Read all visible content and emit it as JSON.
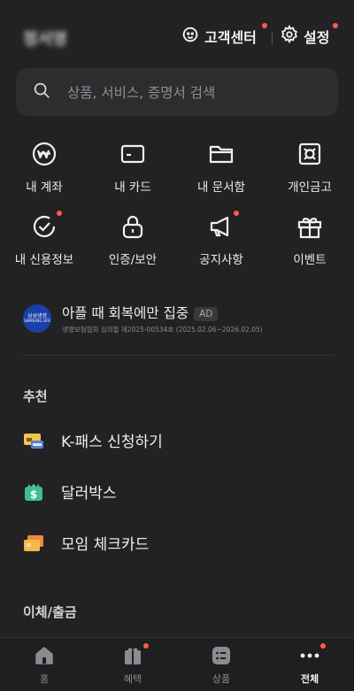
{
  "header": {
    "username": "정서영",
    "support_label": "고객센터",
    "settings_label": "설정"
  },
  "search": {
    "placeholder": "상품, 서비스, 증명서 검색"
  },
  "quick_menu": [
    {
      "label": "내 계좌",
      "icon": "account-won-icon"
    },
    {
      "label": "내 카드",
      "icon": "card-icon"
    },
    {
      "label": "내 문서함",
      "icon": "folder-icon"
    },
    {
      "label": "개인금고",
      "icon": "safe-icon"
    },
    {
      "label": "내 신용정보",
      "icon": "credit-check-icon",
      "badge": true
    },
    {
      "label": "인증/보안",
      "icon": "lock-icon"
    },
    {
      "label": "공지사항",
      "icon": "megaphone-icon",
      "badge": true
    },
    {
      "label": "이벤트",
      "icon": "gift-icon"
    }
  ],
  "ad": {
    "logo_line1": "삼성생명",
    "logo_line2": "SAMSUNG LIFE",
    "title": "아플 때 회복에만 집중",
    "badge": "AD",
    "subtitle": "생명보험협회 심의필 제2025-00534호 (2025.02.06~2026.02.05)"
  },
  "recommend": {
    "title": "추천",
    "items": [
      {
        "label": "K-패스 신청하기",
        "icon": "kpass-card-icon"
      },
      {
        "label": "달러박스",
        "icon": "dollar-box-icon"
      },
      {
        "label": "모임 체크카드",
        "icon": "group-card-icon"
      }
    ]
  },
  "transfer_section_title": "이체/출금",
  "tabs": [
    {
      "label": "홈",
      "icon": "home-icon"
    },
    {
      "label": "혜택",
      "icon": "benefit-gift-icon",
      "badge": true
    },
    {
      "label": "상품",
      "icon": "products-list-icon"
    },
    {
      "label": "전체",
      "icon": "more-dots-icon",
      "badge": true,
      "active": true
    }
  ],
  "colors": {
    "background": "#222224",
    "notification_dot": "#ff5a4f",
    "surface": "#2d2d30"
  }
}
